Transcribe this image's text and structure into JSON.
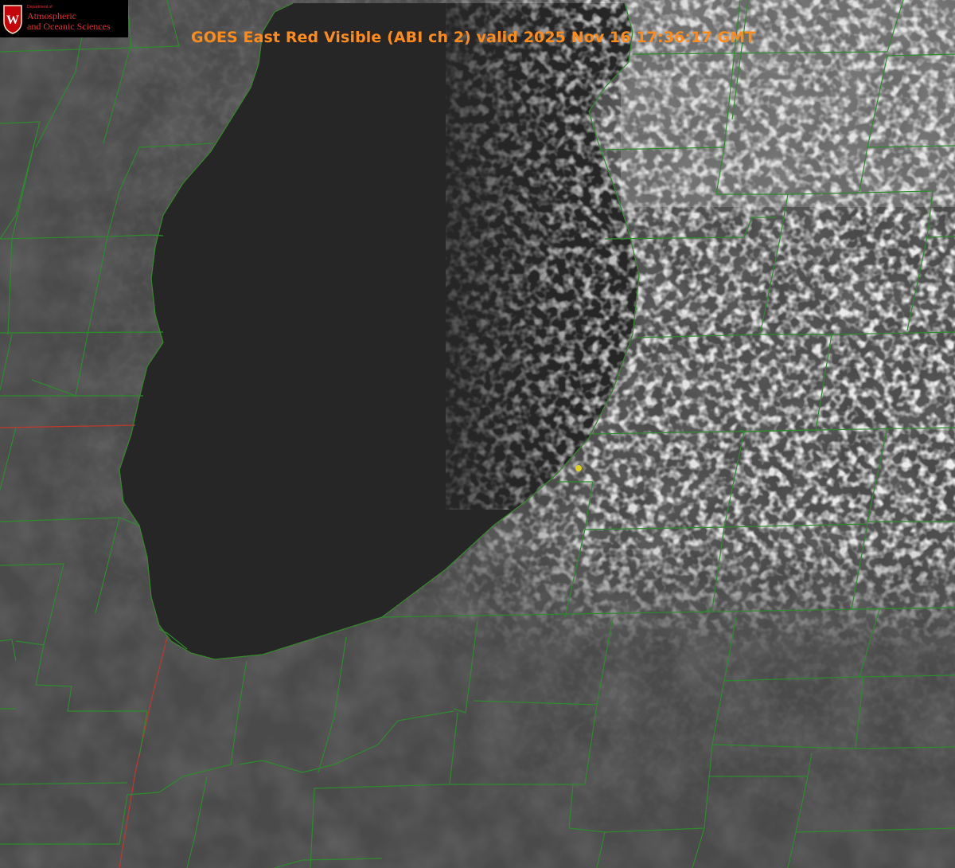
{
  "title": "GOES East Red Visible (ABI ch 2) valid 2025 Nov 16 17:36:17 GMT",
  "logo": {
    "department_of": "Department of",
    "line1": "Atmospheric",
    "line2": "and Oceanic Sciences",
    "shield_letter": "W"
  },
  "colors": {
    "title": "#ff8c1a",
    "land": "#4a4a4a",
    "lake": "#262626",
    "cloud": "#c8c8c8",
    "county_lines": "#2e8b2e",
    "state_lines": "#c0392b",
    "marker": "#e0d020",
    "logo_text": "#e03030"
  },
  "map": {
    "product": "satellite-visible-imagery",
    "water_body": "lake",
    "marker": "station-dot"
  }
}
